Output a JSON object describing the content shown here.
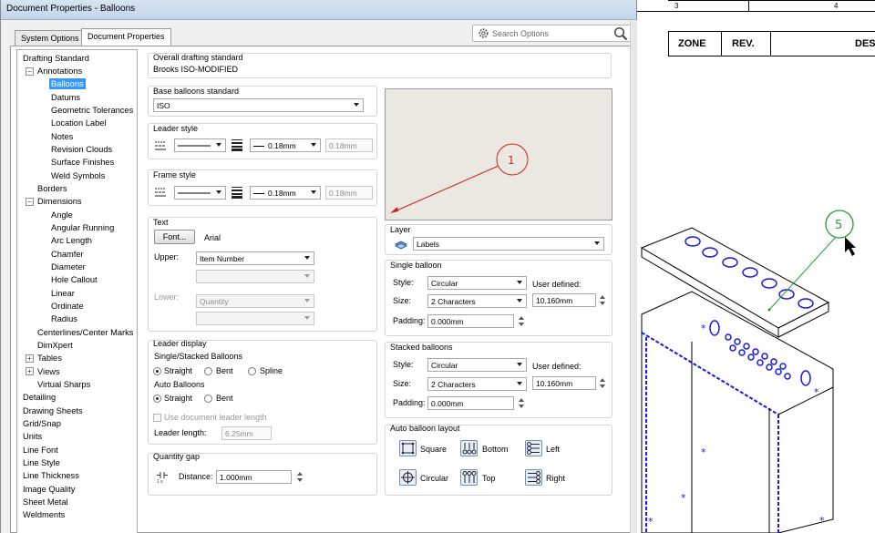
{
  "window": {
    "title": "Document Properties - Balloons"
  },
  "tabs": [
    {
      "label": "System Options"
    },
    {
      "label": "Document Properties"
    }
  ],
  "search": {
    "placeholder": "Search Options"
  },
  "tree": {
    "items": [
      {
        "label": "Drafting Standard"
      },
      {
        "label": "Annotations"
      },
      {
        "label": "Balloons"
      },
      {
        "label": "Datums"
      },
      {
        "label": "Geometric Tolerances"
      },
      {
        "label": "Location Label"
      },
      {
        "label": "Notes"
      },
      {
        "label": "Revision Clouds"
      },
      {
        "label": "Surface Finishes"
      },
      {
        "label": "Weld Symbols"
      },
      {
        "label": "Borders"
      },
      {
        "label": "Dimensions"
      },
      {
        "label": "Angle"
      },
      {
        "label": "Angular Running"
      },
      {
        "label": "Arc Length"
      },
      {
        "label": "Chamfer"
      },
      {
        "label": "Diameter"
      },
      {
        "label": "Hole Callout"
      },
      {
        "label": "Linear"
      },
      {
        "label": "Ordinate"
      },
      {
        "label": "Radius"
      },
      {
        "label": "Centerlines/Center Marks"
      },
      {
        "label": "DimXpert"
      },
      {
        "label": "Tables"
      },
      {
        "label": "Views"
      },
      {
        "label": "Virtual Sharps"
      },
      {
        "label": "Detailing"
      },
      {
        "label": "Drawing Sheets"
      },
      {
        "label": "Grid/Snap"
      },
      {
        "label": "Units"
      },
      {
        "label": "Line Font"
      },
      {
        "label": "Line Style"
      },
      {
        "label": "Line Thickness"
      },
      {
        "label": "Image Quality"
      },
      {
        "label": "Sheet Metal"
      },
      {
        "label": "Weldments"
      }
    ],
    "expander_minus": "−",
    "expander_plus": "+"
  },
  "overall": {
    "label": "Overall drafting standard",
    "value": "Brooks ISO-MODIFIED"
  },
  "base": {
    "label": "Base balloons standard",
    "value": "ISO"
  },
  "leader_style": {
    "label": "Leader style",
    "thickness": "0.18mm",
    "custom": "0.18mm"
  },
  "frame_style": {
    "label": "Frame style",
    "thickness": "0.18mm",
    "custom": "0.18mm"
  },
  "text": {
    "label": "Text",
    "font_button": "Font...",
    "font_name": "Arial",
    "upper_label": "Upper:",
    "upper_value": "Item Number",
    "lower_label": "Lower:",
    "lower_value": "Quantity"
  },
  "leader_display": {
    "label": "Leader display",
    "single_label": "Single/Stacked Balloons",
    "straight": "Straight",
    "bent": "Bent",
    "spline": "Spline",
    "auto_label": "Auto Balloons",
    "use_doc": "Use document leader length",
    "length_label": "Leader length:",
    "length_value": "6.25mm"
  },
  "quantity_gap": {
    "label": "Quantity gap",
    "distance_label": "Distance:",
    "distance_value": "1.000mm"
  },
  "preview": {
    "balloon_number": "1"
  },
  "layer": {
    "label": "Layer",
    "value": "Labels"
  },
  "single": {
    "label": "Single balloon",
    "style_label": "Style:",
    "style": "Circular",
    "size_label": "Size:",
    "size": "2 Characters",
    "user_defined": "User defined:",
    "user_value": "10.160mm",
    "padding_label": "Padding:",
    "padding": "0.000mm"
  },
  "stacked": {
    "label": "Stacked balloons",
    "style_label": "Style:",
    "style": "Circular",
    "size_label": "Size:",
    "size": "2 Characters",
    "user_defined": "User defined:",
    "user_value": "10.160mm",
    "padding_label": "Padding:",
    "padding": "0.000mm"
  },
  "auto_layout": {
    "label": "Auto balloon layout",
    "square": "Square",
    "bottom": "Bottom",
    "left": "Left",
    "circular": "Circular",
    "top": "Top",
    "right": "Right"
  },
  "cad": {
    "col3": "3",
    "col4": "4",
    "zone": "ZONE",
    "rev": "REV.",
    "des": "DES",
    "balloon_number": "5"
  },
  "colors": {
    "selection": "#3399ff",
    "leader_red": "#cc2222",
    "balloon_green": "#2a9a3a",
    "cad_blue": "#1a1ae0"
  }
}
